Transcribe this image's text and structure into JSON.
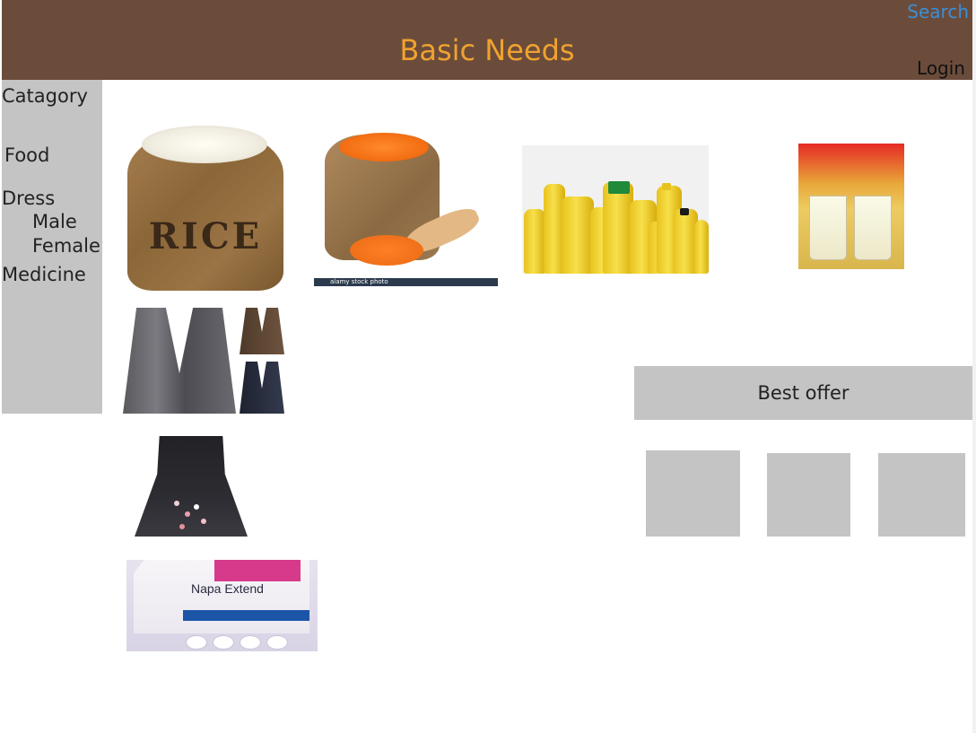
{
  "header": {
    "title": "Basic Needs",
    "search_label": "Search",
    "login_label": "Login",
    "background_color": "#6b4c3b",
    "title_color": "#f0a22f",
    "search_color": "#3b8fd6"
  },
  "sidebar": {
    "heading": "Catagory",
    "items": {
      "food": "Food",
      "dress": "Dress",
      "male": "Male",
      "female": "Female",
      "medicine": "Medicine"
    },
    "background_color": "#c4c4c4"
  },
  "products": {
    "rice": {
      "label": "RICE"
    },
    "lentil": {
      "watermark": "alamy stock photo"
    },
    "medicine": {
      "brand": "Napa Extend"
    }
  },
  "best_offer": {
    "title": "Best offer",
    "box_color": "#c4c4c4"
  }
}
